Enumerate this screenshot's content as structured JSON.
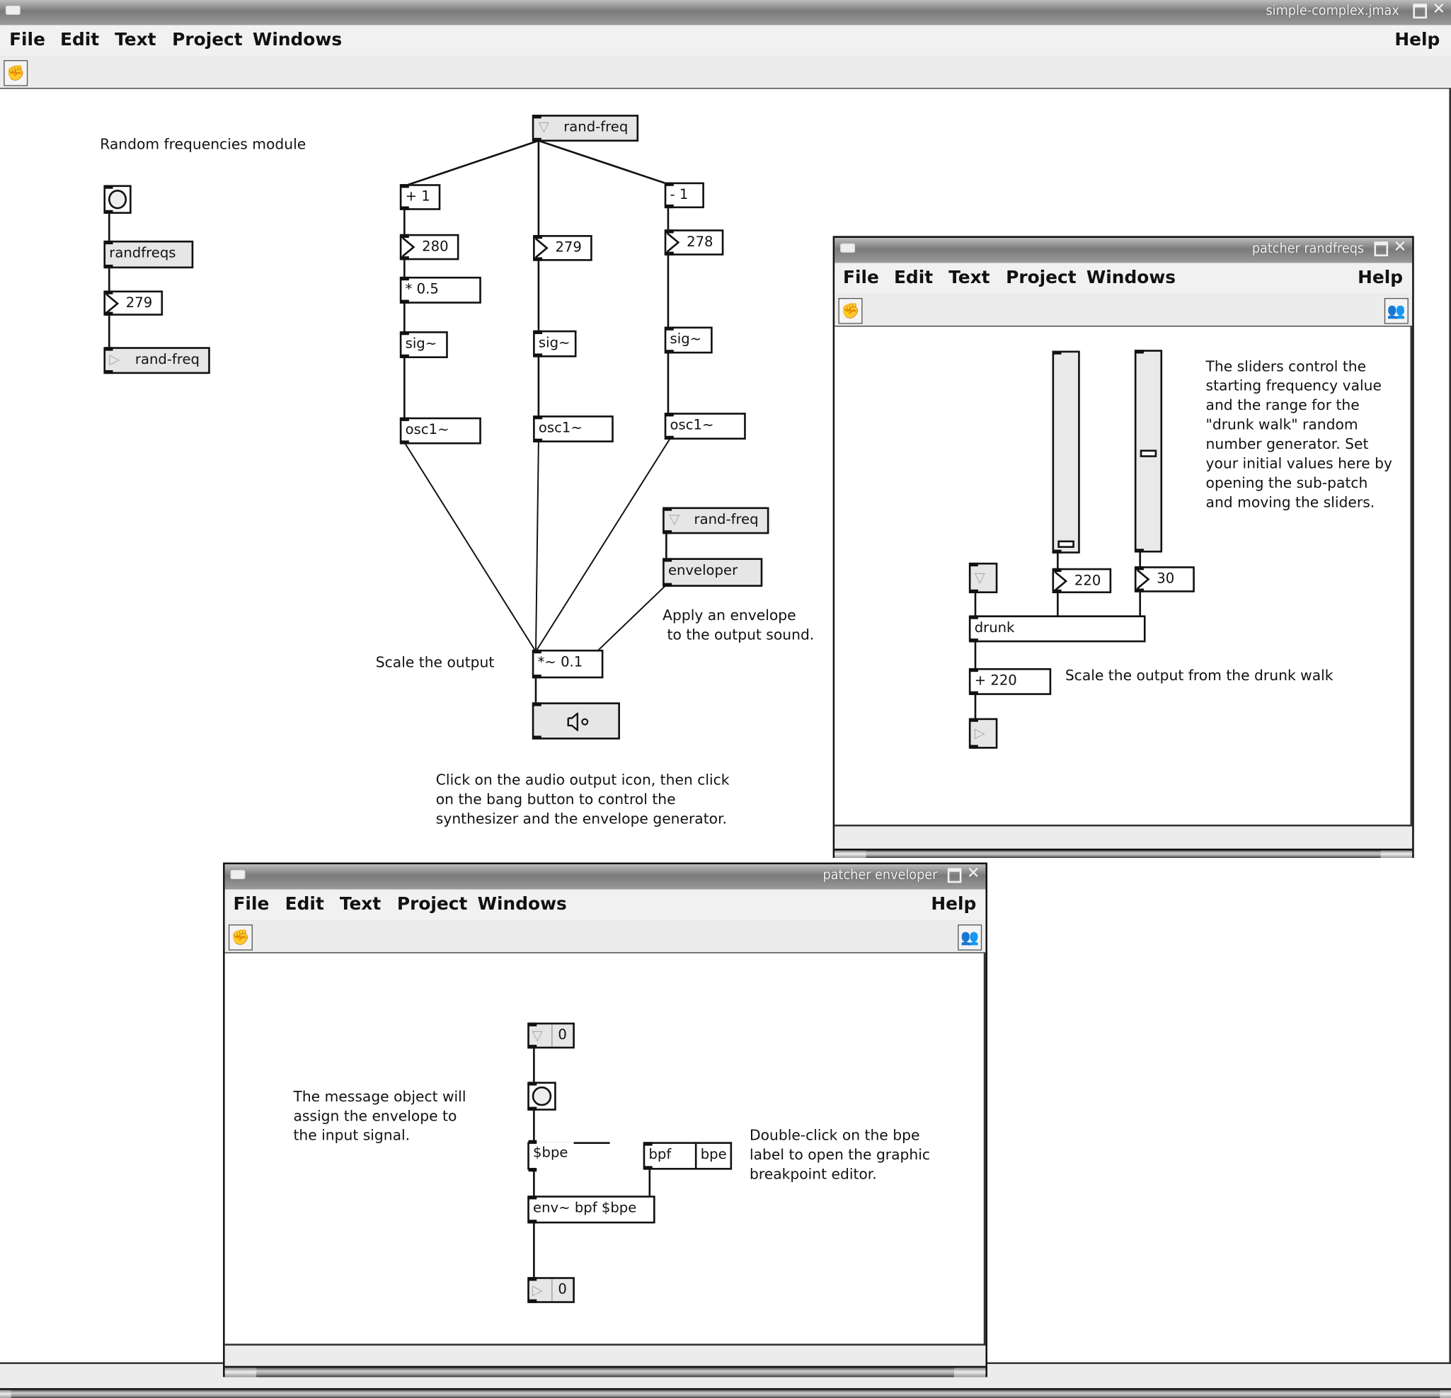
{
  "main_window": {
    "title": "simple-complex.jmax",
    "menu": [
      "File",
      "Edit",
      "Text",
      "Project",
      "Windows"
    ],
    "help": "Help",
    "toolbar": {
      "edit_mode_icon": "hand-icon"
    },
    "patch": {
      "comment_random_module": "Random frequencies module",
      "randfreqs_object": "randfreqs",
      "number_left": "279",
      "send_rand_freq": "rand-freq",
      "receive_rand_freq_top": "rand-freq",
      "plus_one": "+ 1",
      "minus_one": "- 1",
      "number_280": "280",
      "number_279": "279",
      "number_278": "278",
      "mult_half": "* 0.5",
      "sig_1": "sig~",
      "sig_2": "sig~",
      "sig_3": "sig~",
      "osc_1": "osc1~",
      "osc_2": "osc1~",
      "osc_3": "osc1~",
      "receive_rand_freq_env": "rand-freq",
      "enveloper_object": "enveloper",
      "comment_apply_envelope": "Apply an envelope\n to the output sound.",
      "comment_scale_output": "Scale the output",
      "mult_signal": "*~ 0.1",
      "dac_icon": "speaker-icon",
      "comment_click_instructions": "Click on the audio output icon, then click\non the bang button to control the\nsynthesizer and the envelope generator."
    }
  },
  "randfreqs_window": {
    "title": "patcher randfreqs",
    "menu": [
      "File",
      "Edit",
      "Text",
      "Project",
      "Windows"
    ],
    "help": "Help",
    "toolbar": {
      "edit_mode_icon": "hand-icon",
      "users_icon": "users-icon"
    },
    "patch": {
      "slider_start_freq_value": "220",
      "slider_range_value": "30",
      "slider_start_freq_fraction": 0.02,
      "slider_range_fraction": 0.5,
      "comment_sliders": "The sliders control the\nstarting frequency value\nand the range for the\n\"drunk walk\" random\nnumber generator. Set\nyour initial values here by\nopening the sub-patch\nand moving the sliders.",
      "drunk_object": "drunk",
      "plus_220": "+ 220",
      "comment_scale_drunk": "Scale the output from the drunk walk"
    }
  },
  "enveloper_window": {
    "title": "patcher enveloper",
    "menu": [
      "File",
      "Edit",
      "Text",
      "Project",
      "Windows"
    ],
    "help": "Help",
    "toolbar": {
      "edit_mode_icon": "hand-icon",
      "users_icon": "users-icon"
    },
    "patch": {
      "inlet_value": "0",
      "outlet_value": "0",
      "message_bpe": "$bpe",
      "bpf_label": "bpf",
      "bpe_label": "bpe",
      "env_object": "env~ bpf $bpe",
      "comment_message": "The message object will\nassign the envelope to\nthe input signal.",
      "comment_double_click": "Double-click on the bpe\nlabel to open the graphic\nbreakpoint editor."
    }
  }
}
